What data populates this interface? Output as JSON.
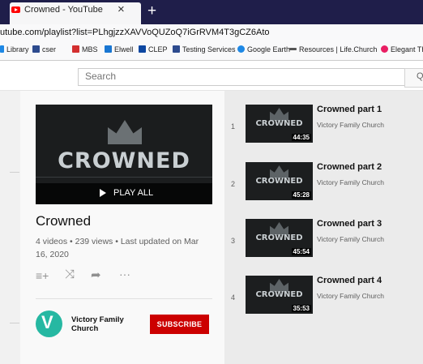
{
  "browser": {
    "tab_title": "Crowned - YouTube",
    "tab_close": "×",
    "new_tab": "+",
    "url": "utube.com/playlist?list=PLhgjzzXAVVoQUZoQ7iGrRVM4T3gCZ6Ato"
  },
  "bookmarks": [
    {
      "label": "Library",
      "color": "#1e88e5"
    },
    {
      "label": "cser",
      "color": "#2d4b8e"
    },
    {
      "label": "MBS",
      "color": "#d32f2f"
    },
    {
      "label": "Elwell",
      "color": "#1976d2"
    },
    {
      "label": "CLEP",
      "color": "#0d47a1"
    },
    {
      "label": "Testing Services",
      "color": "#2d4b8e"
    },
    {
      "label": "Google Earth",
      "color": "#1e88e5"
    },
    {
      "label": "Resources | Life.Church",
      "color": "#555555"
    },
    {
      "label": "Elegant Th",
      "color": "#e91e63"
    }
  ],
  "search": {
    "placeholder": "Search",
    "icon": "search-icon"
  },
  "playlist": {
    "thumbnail_title": "CROWNED",
    "play_all": "PLAY ALL",
    "title": "Crowned",
    "meta": "4 videos • 239 views • Last updated on Mar 16, 2020",
    "actions": [
      "add-to-queue-icon",
      "shuffle-icon",
      "share-icon",
      "more-icon"
    ],
    "add_queue_glyph": "≡+",
    "shuffle_glyph": "⤨",
    "share_glyph": "➦",
    "more_glyph": "···"
  },
  "channel": {
    "name": "Victory Family Church",
    "avatar_letter": "V",
    "avatar_color": "#26b8a2",
    "subscribe_label": "SUBSCRIBE",
    "subscribe_color": "#cc0000"
  },
  "videos": [
    {
      "index": "1",
      "title": "Crowned part 1",
      "channel": "Victory Family Church",
      "duration": "44:35",
      "thumb_text": "CROWNED"
    },
    {
      "index": "2",
      "title": "Crowned part 2",
      "channel": "Victory Family Church",
      "duration": "45:28",
      "thumb_text": "CROWNED"
    },
    {
      "index": "3",
      "title": "Crowned part 3",
      "channel": "Victory Family Church",
      "duration": "45:54",
      "thumb_text": "CROWNED"
    },
    {
      "index": "4",
      "title": "Crowned part 4",
      "channel": "Victory Family Church",
      "duration": "35:53",
      "thumb_text": "CROWNED"
    }
  ]
}
